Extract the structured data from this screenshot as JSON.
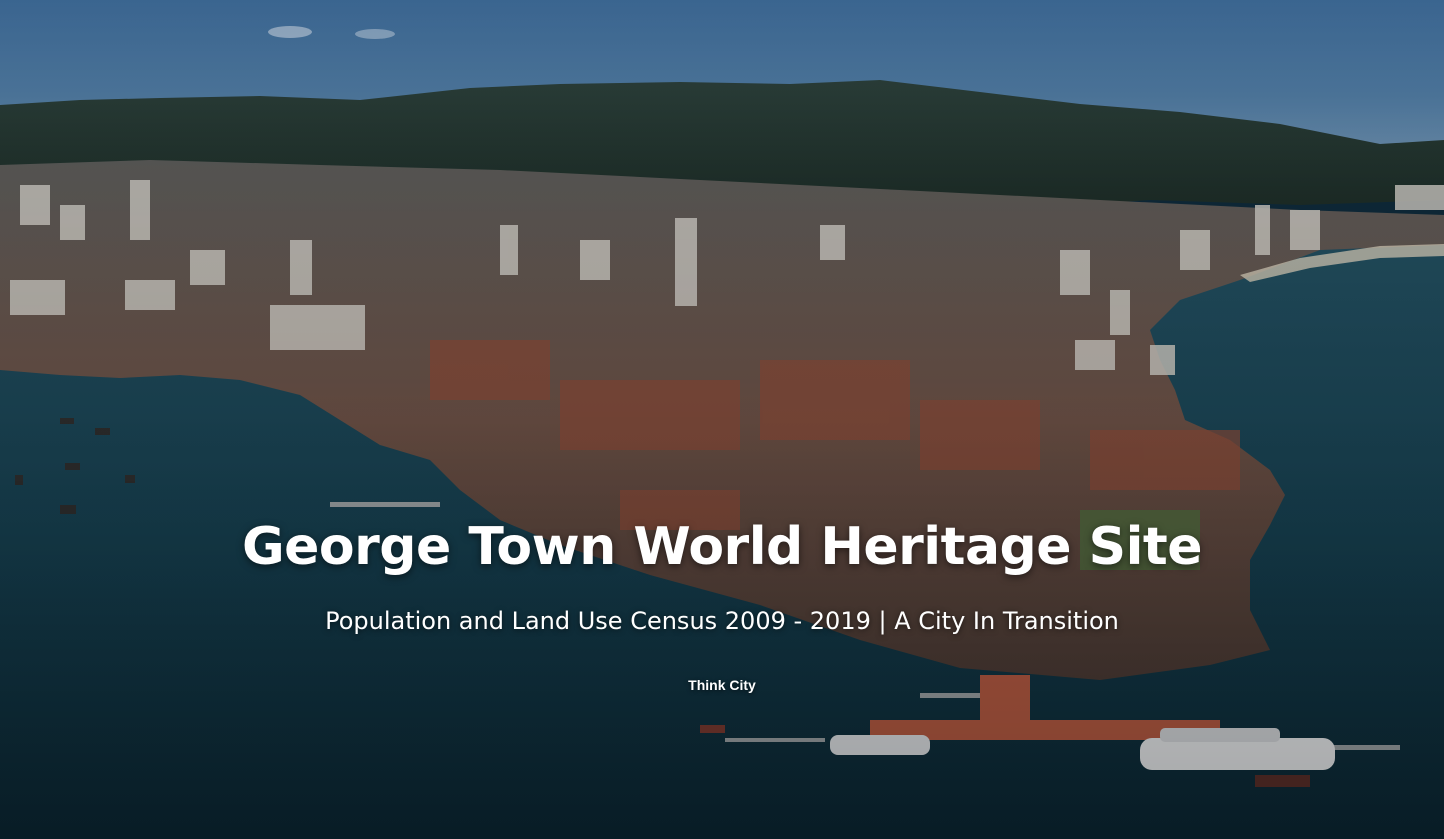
{
  "hero": {
    "title": "George Town World Heritage Site",
    "subtitle": "Population and Land Use Census 2009 - 2019 | A City In Transition",
    "byline": "Think City"
  },
  "colors": {
    "sky": "#3d6a97",
    "mountain": "#22352e",
    "sea": "#163f4f",
    "text": "#ffffff"
  }
}
